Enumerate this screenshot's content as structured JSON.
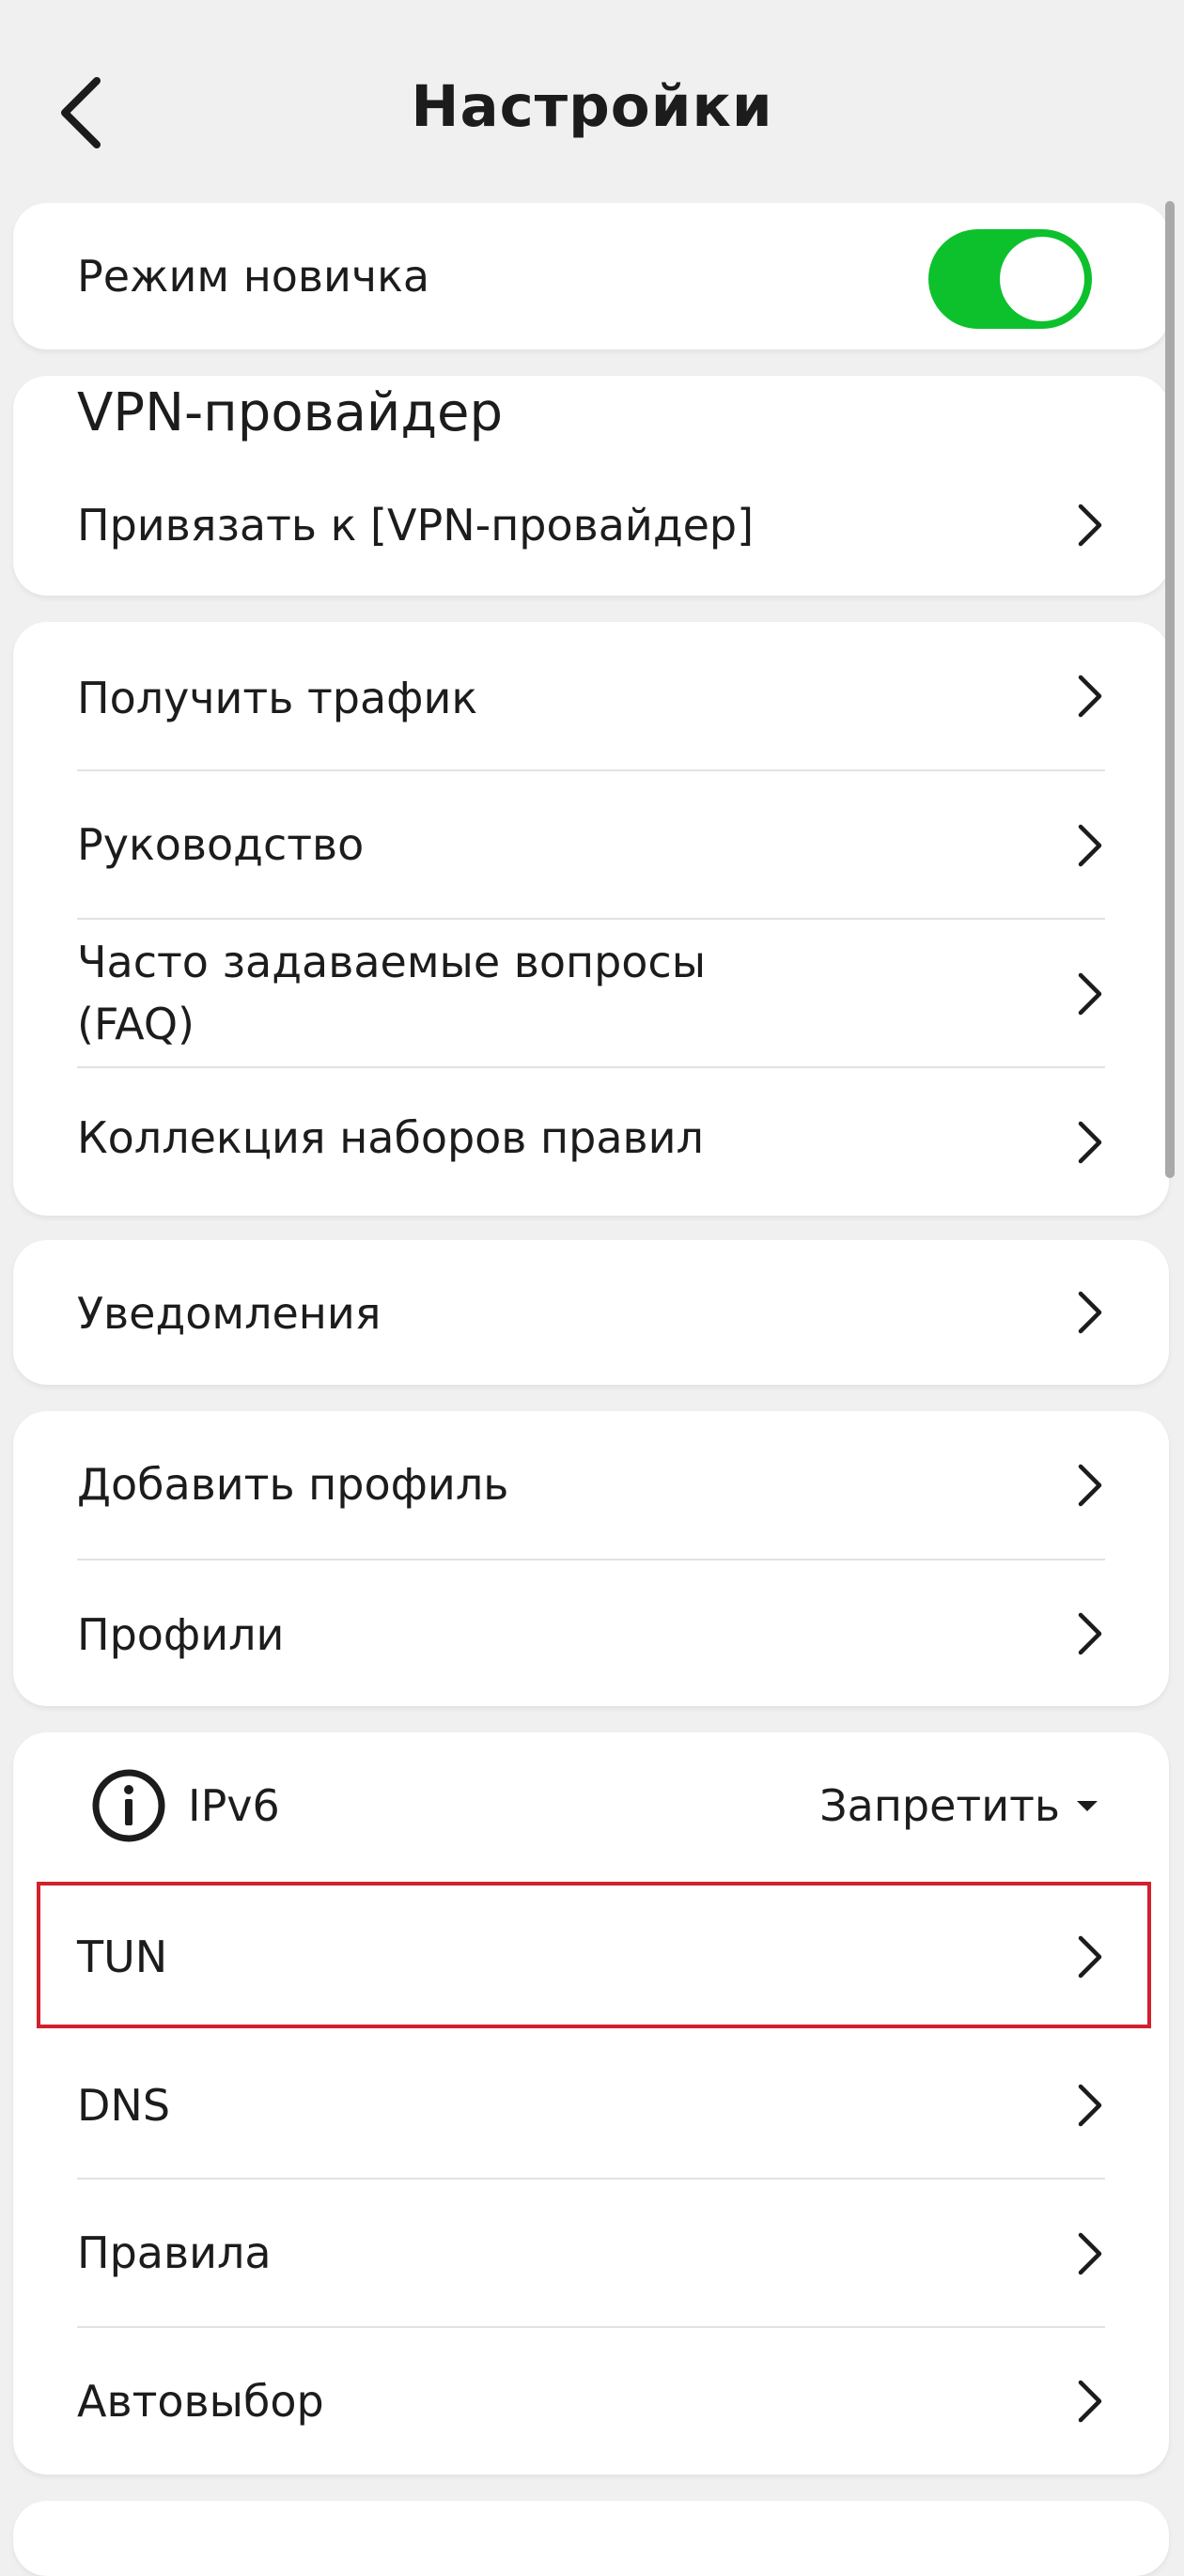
{
  "header": {
    "title": "Настройки",
    "back_icon": "chevron-left-icon"
  },
  "beginner_mode": {
    "label": "Режим новичка",
    "enabled": true,
    "toggle_color": "#0cc12c"
  },
  "vpn_provider": {
    "title": "VPN-провайдер",
    "bind_label": "Привязать к [VPN-провайдер]"
  },
  "help_section": {
    "items": [
      {
        "label": "Получить трафик"
      },
      {
        "label": "Руководство"
      },
      {
        "label": "Часто задаваемые вопросы (FAQ)"
      },
      {
        "label": "Коллекция наборов правил"
      }
    ]
  },
  "notifications": {
    "label": "Уведомления"
  },
  "profiles_section": {
    "items": [
      {
        "label": "Добавить профиль"
      },
      {
        "label": "Профили"
      }
    ]
  },
  "network_section": {
    "ipv6": {
      "icon": "info-icon",
      "label": "IPv6",
      "value": "Запретить"
    },
    "items": [
      {
        "label": "TUN",
        "highlighted": true
      },
      {
        "label": "DNS"
      },
      {
        "label": "Правила"
      },
      {
        "label": "Автовыбор"
      }
    ]
  },
  "colors": {
    "background": "#f0f0f0",
    "card": "#ffffff",
    "accent_toggle": "#0cc12c",
    "highlight_border": "#d2202e"
  }
}
